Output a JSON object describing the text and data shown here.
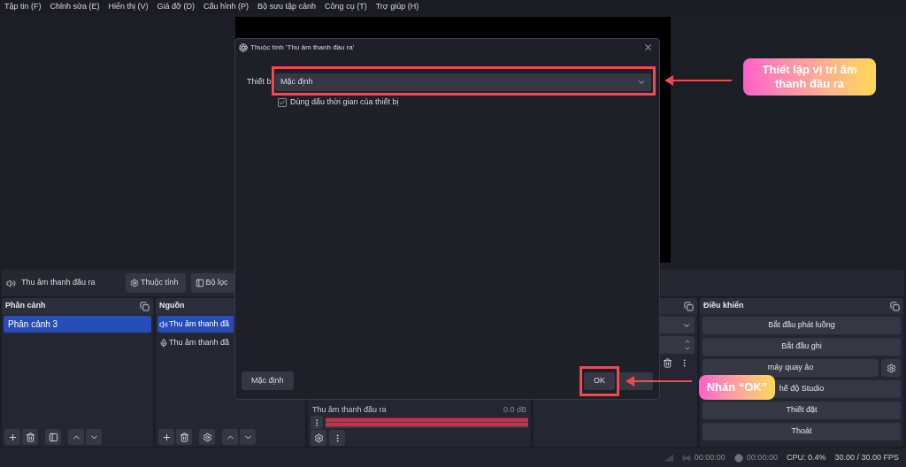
{
  "menu": [
    "Tập tin (F)",
    "Chỉnh sửa (E)",
    "Hiển thị (V)",
    "Giá đỡ (D)",
    "Cấu hình (P)",
    "Bộ sưu tập cảnh",
    "Công cụ (T)",
    "Trợ giúp (H)"
  ],
  "source_toolbar": {
    "source": "Thu âm thanh đầu ra",
    "buttons": [
      {
        "label": "Thuộc tính",
        "kind": "gear"
      },
      {
        "label": "Bộ lọc",
        "kind": "filter"
      }
    ]
  },
  "scenes": {
    "title": "Phân cảnh",
    "items": [
      {
        "label": "Phân cảnh 3",
        "selected": true
      }
    ]
  },
  "sources": {
    "title": "Nguồn",
    "items": [
      {
        "label": "Thu âm thanh đầ",
        "kind": "speaker",
        "selected": true
      },
      {
        "label": "Thu âm thanh đầ",
        "kind": "mic",
        "selected": false
      }
    ]
  },
  "mixer": {
    "channels": [
      {
        "name": "Thu âm thanh đầu ra",
        "reading": "0.0 dB",
        "level": 1
      }
    ]
  },
  "controls": {
    "title": "Điều khiển",
    "buttons": [
      {
        "label": "Bắt đầu phát luồng",
        "kind": "plain"
      },
      {
        "label": "Bắt đầu ghi",
        "kind": "plain"
      },
      {
        "label": "máy quay ảo",
        "kind": "with_settings"
      },
      {
        "label": "hế độ Studio",
        "kind": "plain"
      },
      {
        "label": "Thiết đặt",
        "kind": "plain"
      },
      {
        "label": "Thoát",
        "kind": "plain"
      }
    ]
  },
  "status_bar": {
    "stream_time": "00:00:00",
    "record_time": "00:00:00",
    "cpu": "CPU: 0.4%",
    "fps": "30.00 / 30.00 FPS"
  },
  "dialog": {
    "title": "Thuộc tính 'Thu âm thanh đầu ra'",
    "field_label": "Thiết b",
    "device": "Mặc định",
    "timestamps": {
      "label": "Dùng dấu thời gian của thiết bị",
      "checked": true
    },
    "defaults_button": "Mặc định",
    "ok_button": "OK"
  },
  "annotations": [
    "Thiết lập vị trí âm thanh đầu ra",
    "Nhấn “OK”"
  ]
}
